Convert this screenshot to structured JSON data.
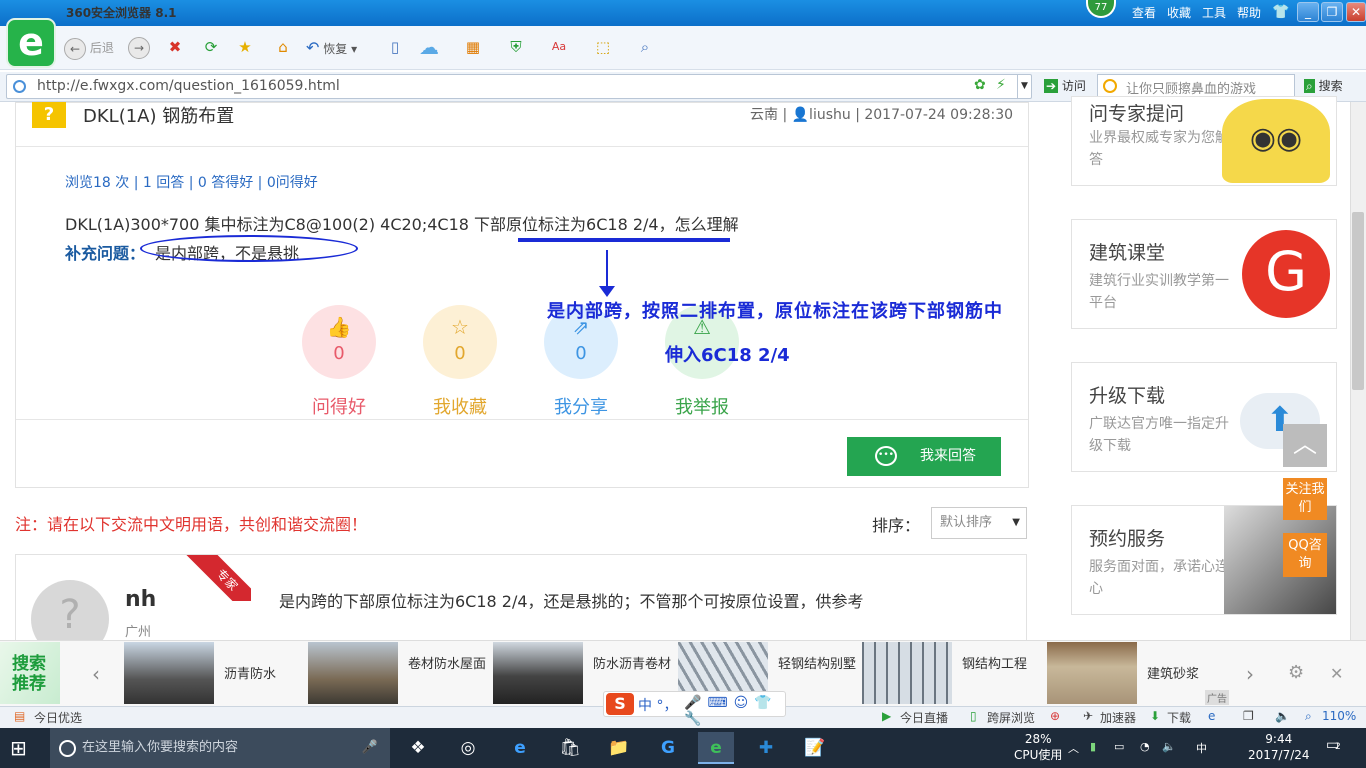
{
  "browser": {
    "title": "360安全浏览器 8.1",
    "score": "77",
    "top_menu": [
      "查看",
      "收藏",
      "工具",
      "帮助"
    ],
    "toolbar": {
      "back": "后退",
      "restore": "恢复"
    },
    "url": "http://e.fwxgx.com/question_1616059.html",
    "visit": "访问",
    "search_placeholder": "让你只顾擦鼻血的游戏",
    "search_button": "搜索"
  },
  "question": {
    "title": "DKL(1A) 钢筋布置",
    "meta": "云南 | 👤liushu | 2017-07-24 09:28:30",
    "stats": "浏览18 次 | 1 回答 | 0 答得好 | 0问得好",
    "body": "DKL(1A)300*700  集中标注为C8@100(2) 4C20;4C18   下部原位标注为6C18 2/4，怎么理解",
    "supplement_label": "补充问题：",
    "supplement": "是内部跨，不是悬挑"
  },
  "annotation": {
    "line1": "是内部跨，按照二排布置，原位标注在该跨下部钢筋中",
    "line2": "伸入6C18 2/4"
  },
  "actions": [
    {
      "label": "问得好",
      "count": "0",
      "icon": "thumbs-up-icon"
    },
    {
      "label": "我收藏",
      "count": "0",
      "icon": "star-icon"
    },
    {
      "label": "我分享",
      "count": "0",
      "icon": "share-icon"
    },
    {
      "label": "我举报",
      "count": "",
      "icon": "warning-icon"
    }
  ],
  "answer_button": "我来回答",
  "notice": "注：请在以下交流中文明用语，共创和谐交流圈！",
  "sort": {
    "label": "排序：",
    "value": "默认排序"
  },
  "answer": {
    "name": "nh",
    "location": "广州",
    "badge": "专家",
    "text": "是内跨的下部原位标注为6C18 2/4，还是悬挑的；不管那个可按原位设置，供参考"
  },
  "sidebar": [
    {
      "title": "问专家提问",
      "sub": "业界最权威专家为您解答"
    },
    {
      "title": "建筑课堂",
      "sub": "建筑行业实训教学第一平台"
    },
    {
      "title": "升级下载",
      "sub": "广联达官方唯一指定升级下载"
    },
    {
      "title": "预约服务",
      "sub": "服务面对面，承诺心连心"
    }
  ],
  "float": {
    "follow": "关注我们",
    "qq": "QQ咨询"
  },
  "recommend": {
    "label": "搜索推荐",
    "items": [
      "沥青防水",
      "卷材防水屋面",
      "防水沥青卷材",
      "轻钢结构别墅",
      "钢结构工程",
      "建筑砂浆"
    ],
    "ad": "广告"
  },
  "status": {
    "today": "今日优选",
    "live": "今日直播",
    "cross": "跨屏浏览",
    "accel": "加速器",
    "download": "下载",
    "zoom": "110%"
  },
  "ime": "中 °，",
  "taskbar": {
    "search": "在这里输入你要搜索的内容",
    "cpu_pct": "28%",
    "cpu_label": "CPU使用",
    "time": "9:44",
    "date": "2017/7/24",
    "notif": "2"
  }
}
